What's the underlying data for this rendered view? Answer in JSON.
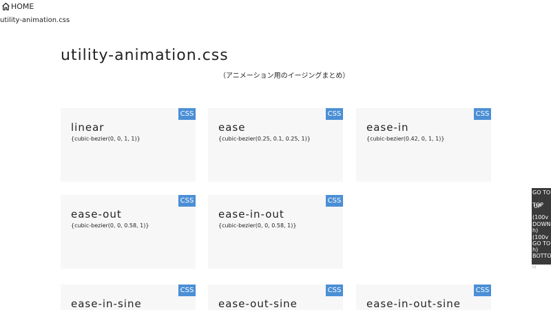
{
  "nav": {
    "home_icon": "home-icon",
    "home_label": "HOME",
    "breadcrumb": "utility-animation.css"
  },
  "header": {
    "title": "utility-animation.css",
    "subtitle": "（アニメーション用のイージングまとめ）"
  },
  "cards": [
    {
      "title": "linear",
      "value": "{cubic-bezier(0, 0, 1, 1)}",
      "badge": "CSS"
    },
    {
      "title": "ease",
      "value": "{cubic-bezier(0.25, 0.1, 0.25, 1)}",
      "badge": "CSS"
    },
    {
      "title": "ease-in",
      "value": "{cubic-bezier(0.42, 0, 1, 1)}",
      "badge": "CSS"
    },
    {
      "title": "ease-out",
      "value": "{cubic-bezier(0, 0, 0.58, 1)}",
      "badge": "CSS"
    },
    {
      "title": "ease-in-out",
      "value": "{cubic-bezier(0, 0, 0.58, 1)}",
      "badge": "CSS"
    },
    {
      "title": "ease-in-sine",
      "badge": "CSS"
    },
    {
      "title": "ease-out-sine",
      "badge": "CSS"
    },
    {
      "title": "ease-in-out-sine",
      "badge": "CSS"
    }
  ],
  "scroll_nav": {
    "go_to_top": "GO TO",
    "top": "TOP",
    "up": "UP",
    "up_unit": "(100v",
    "down": "DOWN",
    "down_unit_suffix": "h)",
    "down_unit": "(100v",
    "go_to_bottom": "GO TO",
    "bottom_suffix": "h)",
    "bottom": "BOTTO",
    "bottom_end": "M"
  },
  "colors": {
    "accent": "#4b8fd6",
    "card_bg": "#f7f7f7",
    "panel_bg": "#3a3a3a"
  }
}
